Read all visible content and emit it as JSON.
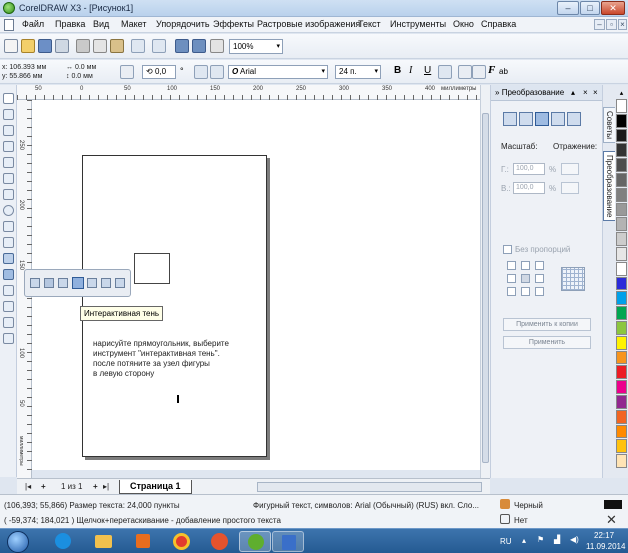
{
  "window": {
    "title": "CorelDRAW X3 - [Рисунок1]",
    "controls": [
      "–",
      "□",
      "✕"
    ]
  },
  "menu": {
    "items": [
      "Файл",
      "Правка",
      "Вид",
      "Макет",
      "Упорядочить",
      "Эффекты",
      "Растровые изображения",
      "Текст",
      "Инструменты",
      "Окно",
      "Справка"
    ],
    "mdi_controls": [
      "–",
      "▫",
      "×"
    ]
  },
  "toolbar": {
    "zoom_value": "100%",
    "zoom_arrow": "▾"
  },
  "propbar": {
    "x_label": "x:",
    "x_value": "106.393 мм",
    "y_label": "y:",
    "y_value": "55.866 мм",
    "w_value": "0.0 мм",
    "h_value": "0.0 мм",
    "rotation": "0,0",
    "degree": "°",
    "font_icon": "O",
    "font_name": "Arial",
    "font_size": "24 п.",
    "arrow": "▾",
    "fmt_bold": "B",
    "fmt_italic": "I",
    "fmt_underline": "U",
    "fmt_text": "F",
    "fmt_ab": "ab"
  },
  "rulers": {
    "h_ticks": [
      "50",
      "0",
      "50",
      "100",
      "150",
      "200",
      "250",
      "300",
      "350",
      "400"
    ],
    "h_unit": "миллиметры",
    "v_ticks": [
      "250",
      "200",
      "150",
      "100",
      "50"
    ],
    "v_unit": "миллиметры"
  },
  "canvas": {
    "tooltip": "Интерактивная тень",
    "instructions": [
      "нарисуйте прямоугольник, выберите",
      "инструмент \"интерактивная тень\".",
      "после потяните за узел фигуры",
      "в левую сторону"
    ],
    "text_cursor": "I"
  },
  "pagebar": {
    "first": "|◂",
    "add_before": "+",
    "counter": "1 из 1",
    "add_after": "+",
    "last": "▸|",
    "tab": "Страница 1"
  },
  "docker": {
    "header": "Преобразование",
    "header_icons": [
      "»",
      "▴",
      "×",
      "×"
    ],
    "scale_label": "Масштаб:",
    "mirror_label": "Отражение:",
    "h_label": "Г.:",
    "h_value": "100,0",
    "v_label": "В.:",
    "v_value": "100,0",
    "percent": "%",
    "proportions": "Без пропорций",
    "apply_copy": "Применить к копии",
    "apply": "Применить"
  },
  "docker_tabs": [
    "Советы",
    "Преобразование"
  ],
  "palette": {
    "colors": [
      "#ffffff",
      "#000000",
      "#1a1a1a",
      "#333333",
      "#4d4d4d",
      "#666666",
      "#808080",
      "#999999",
      "#b3b3b3",
      "#cccccc",
      "#e6e6e6",
      "#ffffff",
      "#2b2bd9",
      "#00a0e9",
      "#00a651",
      "#8cc63f",
      "#fff200",
      "#f7941d",
      "#ed1c24",
      "#ec008c",
      "#92278f",
      "#f26522",
      "#ff8a00",
      "#ffc20e",
      "#ffe4b5"
    ]
  },
  "status": {
    "line1": "(106,393; 55,866)  Размер текста: 24,000 пункты",
    "line1_mid": "Фигурный текст, символов: Arial (Обычный) (RUS) вкл. Сло...",
    "fill_label": "Черный",
    "line2": "( -59,374; 184,021 )   Щелчок+перетаскивание - добавление простого текста",
    "outline_label": "Нет"
  },
  "taskbar": {
    "lang": "RU",
    "time": "22:17",
    "date": "11.09.2014",
    "apps": [
      "start-orb",
      "ie",
      "explorer",
      "media-player",
      "chrome",
      "opera",
      "corel",
      "word"
    ],
    "colors": {
      "ie": "#1b8fe0",
      "explorer": "#f2c14e",
      "media-player": "#e96d1e",
      "chrome": "#e23b2e",
      "opera": "#e5532d",
      "corel": "#5fae2e",
      "word": "#3a6fc9"
    }
  }
}
